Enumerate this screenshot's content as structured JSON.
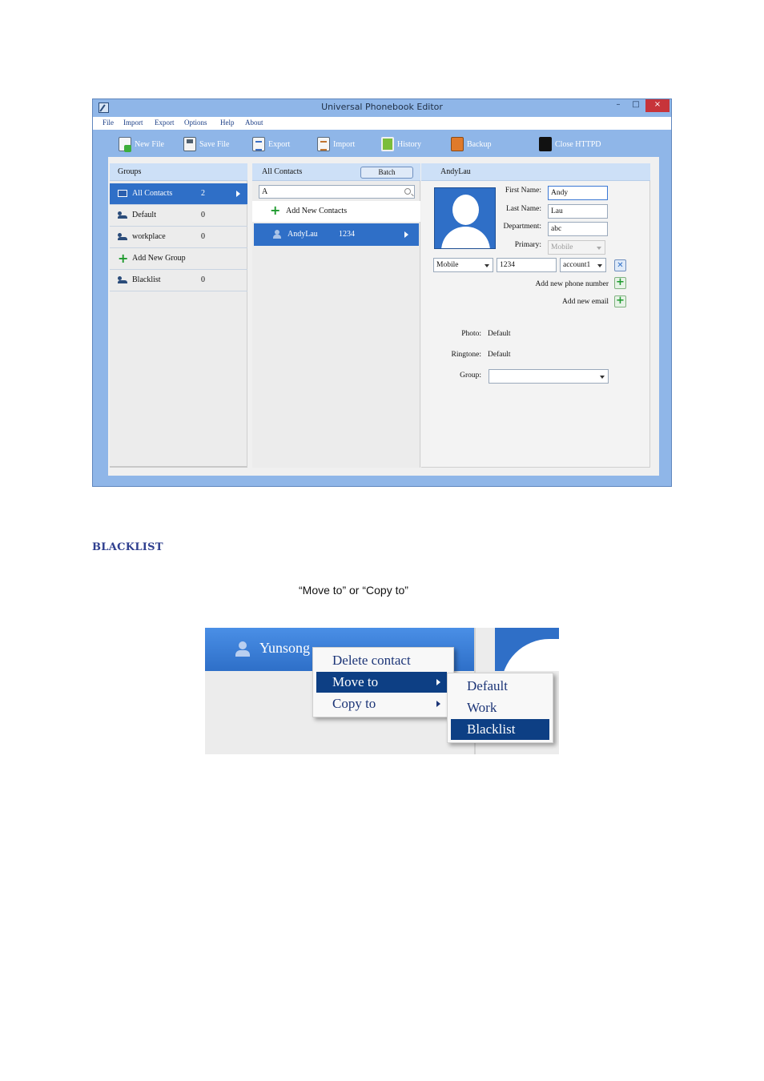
{
  "window": {
    "title": "Universal Phonebook Editor",
    "controls": {
      "minimize": "–",
      "maximize": "□",
      "close": "×"
    }
  },
  "menu": [
    "File",
    "Import",
    "Export",
    "Options",
    "Help",
    "About"
  ],
  "toolbar": {
    "new_file": "New File",
    "save_file": "Save File",
    "export": "Export",
    "import": "Import",
    "history": "History",
    "backup": "Backup",
    "close_httpd": "Close HTTPD"
  },
  "groups": {
    "header": "Groups",
    "items": [
      {
        "label": "All Contacts",
        "count": "2",
        "icon": "contacts-card-icon"
      },
      {
        "label": "Default",
        "count": "0",
        "icon": "group-icon"
      },
      {
        "label": "workplace",
        "count": "0",
        "icon": "group-icon"
      },
      {
        "label": "Add New Group",
        "count": "",
        "icon": "plus-icon"
      },
      {
        "label": "Blacklist",
        "count": "0",
        "icon": "group-icon"
      }
    ]
  },
  "contacts": {
    "header": "All Contacts",
    "batch_label": "Batch",
    "search_value": "A",
    "add_label": "Add New Contacts",
    "rows": [
      {
        "name": "AndyLau",
        "phone": "1234"
      }
    ]
  },
  "detail": {
    "header": "AndyLau",
    "first_name_label": "First Name:",
    "first_name": "Andy",
    "last_name_label": "Last Name:",
    "last_name": "Lau",
    "department_label": "Department:",
    "department": "abc",
    "primary_label": "Primary:",
    "primary": "Mobile",
    "phone_type": "Mobile",
    "phone_number": "1234",
    "phone_account": "account1",
    "add_phone_label": "Add new phone number",
    "add_email_label": "Add new email",
    "photo_label": "Photo:",
    "photo_value": "Default",
    "ringtone_label": "Ringtone:",
    "ringtone_value": "Default",
    "group_label": "Group:",
    "group_value": ""
  },
  "doc": {
    "heading": "BLACKLIST",
    "instruction": "“Move to” or “Copy to”"
  },
  "context_shot": {
    "contact_name": "Yunsong",
    "menu_items": [
      "Delete contact",
      "Move to",
      "Copy to"
    ],
    "submenu_items": [
      "Default",
      "Work",
      "Blacklist"
    ]
  },
  "colors": {
    "window_frame": "#8fb6e8",
    "selection": "#2f6fc7",
    "menu_selection": "#0d3f84",
    "heading": "#2f3f8f",
    "close_button": "#c7343a"
  }
}
